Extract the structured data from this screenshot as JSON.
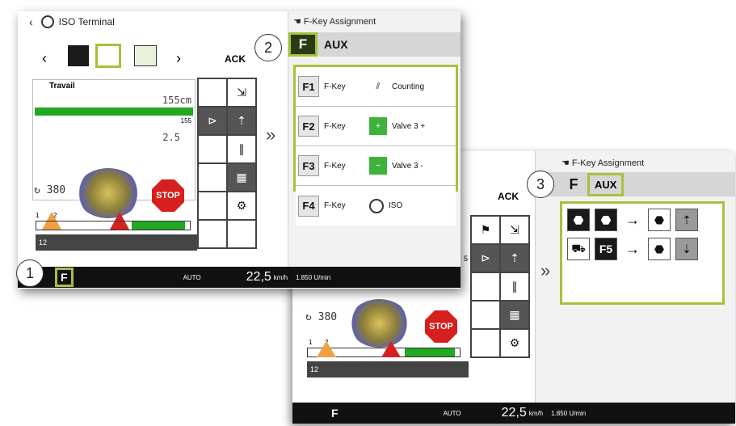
{
  "front": {
    "topbar": {
      "back_icon": "chevron-left-icon",
      "title": "ISO Terminal"
    },
    "fkey_title": "F-Key Assignment",
    "ack": "ACK",
    "aux": "AUX",
    "fkey_icon": "F",
    "work": {
      "mode": "Travail",
      "width": "155cm",
      "small": "155",
      "value": "2.5",
      "count": "380"
    },
    "stop": "STOP",
    "fkeys": [
      {
        "key": "F1",
        "word": "F-Key",
        "function": "Counting"
      },
      {
        "key": "F2",
        "word": "F-Key",
        "function": "Valve 3 +"
      },
      {
        "key": "F3",
        "word": "F-Key",
        "function": "Valve 3 -"
      },
      {
        "key": "F4",
        "word": "F-Key",
        "function": "ISO"
      }
    ],
    "bottom": {
      "fkey": "F",
      "auto": "AUTO",
      "speed": "22,5",
      "speed_unit": "km/h",
      "rpm": "1.850 U/min"
    },
    "markers": [
      "1",
      "2"
    ],
    "tick_labels": [
      "1",
      "2"
    ],
    "tick_small": "12"
  },
  "back": {
    "fkey_title": "F-Key Assignment",
    "ack": "ACK",
    "aux": "AUX",
    "fkey_icon": "F",
    "count": "380",
    "stop": "STOP",
    "f5": "F5",
    "tick_labels": [
      "1",
      "2"
    ],
    "tick_small": "12",
    "bottom": {
      "fkey": "F",
      "auto": "AUTO",
      "speed": "22,5",
      "speed_unit": "km/h",
      "rpm": "1.850 U/min"
    },
    "marker": "3",
    "side_numbers": [
      "5"
    ]
  },
  "chevrons": "»",
  "colors": {
    "accent_green": "#a7c13a",
    "valve_green": "#3db33d",
    "stop_red": "#d62020",
    "bar_green": "#22a822"
  }
}
